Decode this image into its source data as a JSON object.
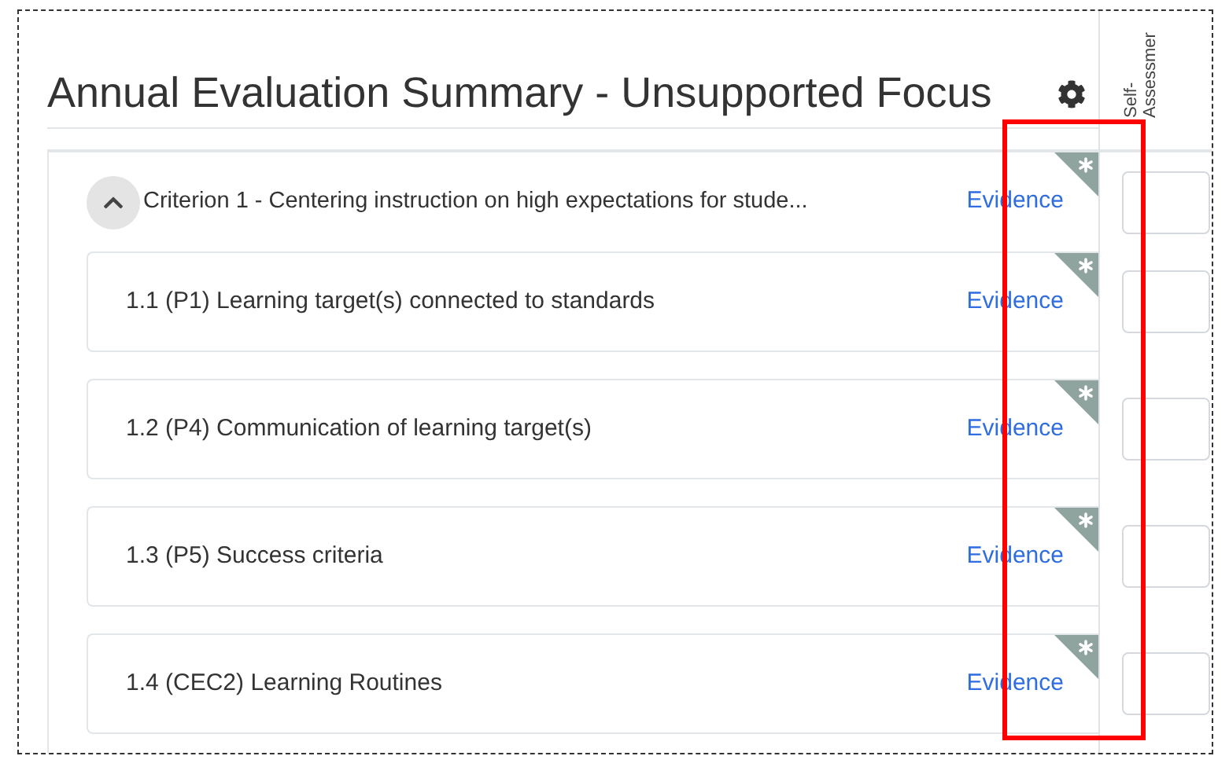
{
  "title": "Annual Evaluation Summary - Unsupported Focus",
  "column_header": "Self-Assessmer",
  "criterion": {
    "label": "Criterion 1 - Centering instruction on high expectations for stude...",
    "expanded": true,
    "link": "Evidence"
  },
  "items": [
    {
      "label": "1.1 (P1) Learning target(s) connected to standards",
      "link": "Evidence"
    },
    {
      "label": "1.2 (P4) Communication of learning target(s)",
      "link": "Evidence"
    },
    {
      "label": "1.3 (P5) Success criteria",
      "link": "Evidence"
    },
    {
      "label": "1.4 (CEC2) Learning Routines",
      "link": "Evidence"
    }
  ]
}
